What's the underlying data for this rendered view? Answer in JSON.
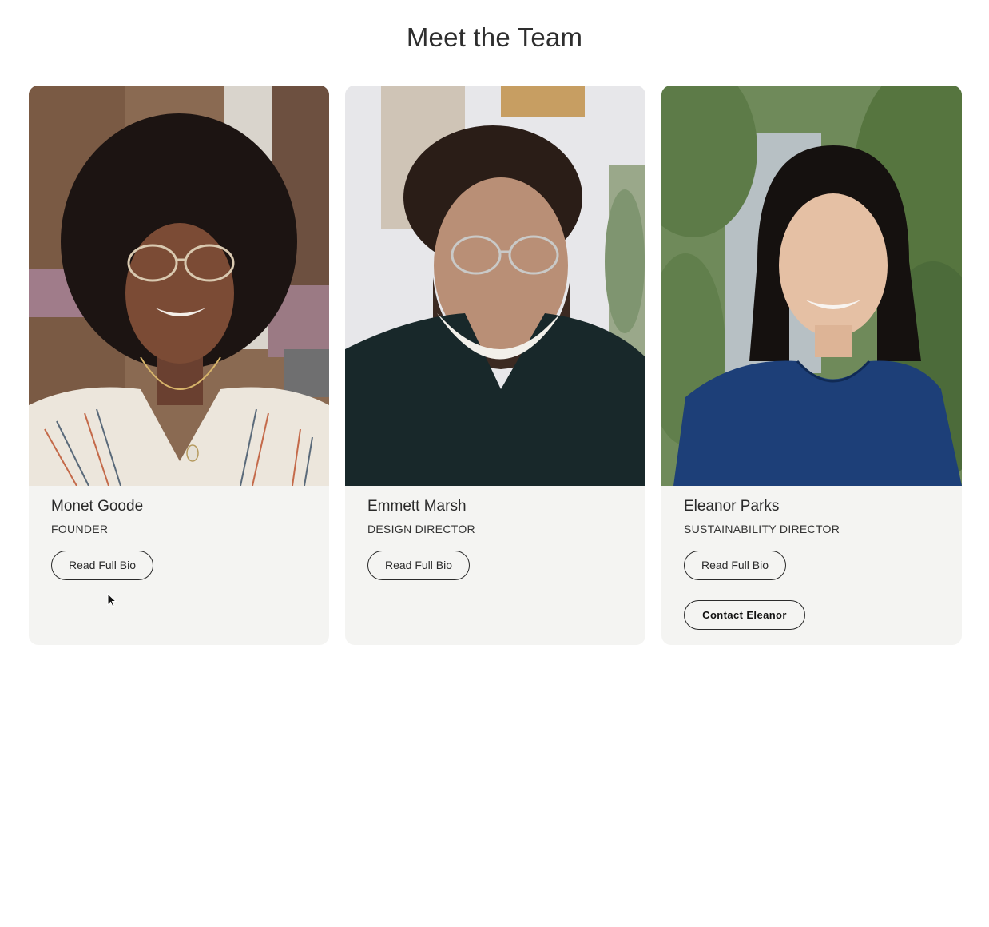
{
  "page": {
    "title": "Meet the Team"
  },
  "team": [
    {
      "name": "Monet Goode",
      "role": "FOUNDER",
      "bio_label": "Read Full Bio"
    },
    {
      "name": "Emmett Marsh",
      "role": "DESIGN DIRECTOR",
      "bio_label": "Read Full Bio"
    },
    {
      "name": "Eleanor Parks",
      "role": "SUSTAINABILITY DIRECTOR",
      "bio_label": "Read Full Bio",
      "contact_label": "Contact Eleanor"
    }
  ],
  "colors": {
    "card_background": "#f4f4f2",
    "text": "#2b2b2b",
    "button_border": "#2b2b2b"
  }
}
